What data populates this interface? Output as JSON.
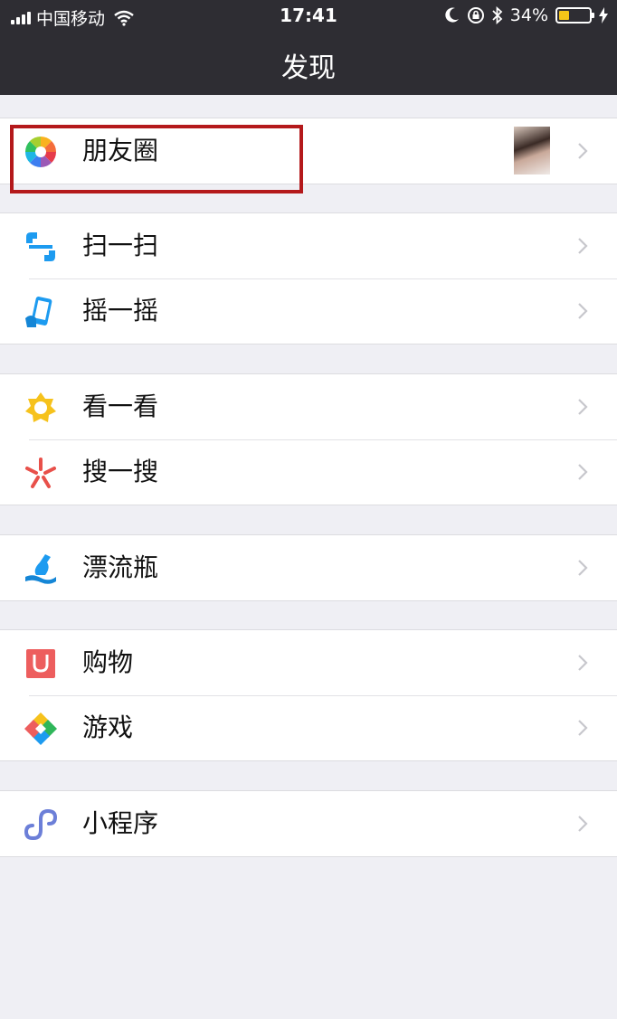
{
  "status_bar": {
    "carrier": "中国移动",
    "time": "17:41",
    "battery_percent": "34%",
    "battery_level": 0.34
  },
  "nav": {
    "title": "发现"
  },
  "groups": [
    {
      "items": [
        {
          "label": "朋友圈",
          "icon": "moments-icon",
          "has_thumbnail": true
        }
      ]
    },
    {
      "items": [
        {
          "label": "扫一扫",
          "icon": "scan-icon"
        },
        {
          "label": "摇一摇",
          "icon": "shake-icon"
        }
      ]
    },
    {
      "items": [
        {
          "label": "看一看",
          "icon": "top-stories-icon"
        },
        {
          "label": "搜一搜",
          "icon": "search-icon"
        }
      ]
    },
    {
      "items": [
        {
          "label": "漂流瓶",
          "icon": "drift-bottle-icon"
        }
      ]
    },
    {
      "items": [
        {
          "label": "购物",
          "icon": "shopping-icon"
        },
        {
          "label": "游戏",
          "icon": "games-icon"
        }
      ]
    },
    {
      "items": [
        {
          "label": "小程序",
          "icon": "mini-program-icon"
        }
      ]
    }
  ],
  "colors": {
    "nav_bg": "#2e2d33",
    "page_bg": "#efeff4",
    "highlight": "#b4191b"
  }
}
